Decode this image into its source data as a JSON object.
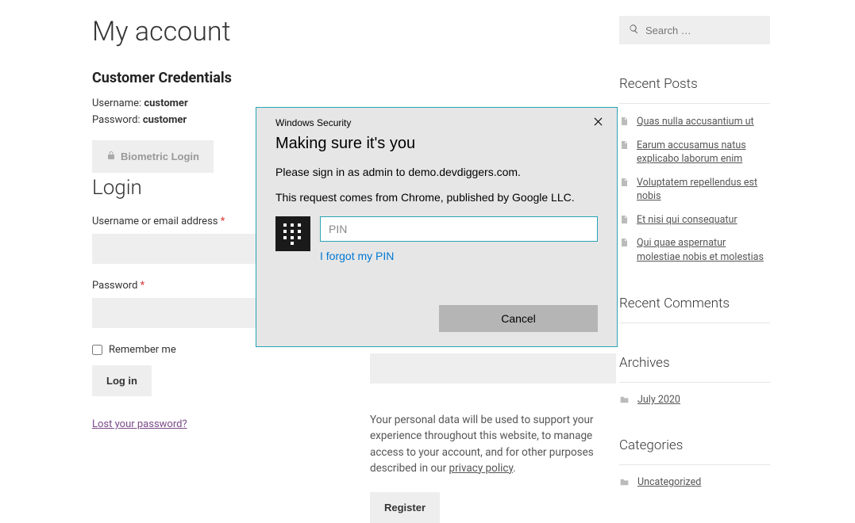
{
  "page": {
    "title": "My account",
    "credentials_heading": "Customer Credentials",
    "username_label": "Username:",
    "username_value": "customer",
    "password_label": "Password:",
    "password_value": "customer",
    "biometric_label": "Biometric Login",
    "login_heading": "Login"
  },
  "login_form": {
    "username_label": "Username or email address",
    "password_label": "Password",
    "remember_label": "Remember me",
    "login_button": "Log in",
    "lost_password": "Lost your password?"
  },
  "register_form": {
    "privacy_note_prefix": "Your personal data will be used to support your experience throughout this website, to manage access to your account, and for other purposes described in our ",
    "privacy_link": "privacy policy",
    "register_button": "Register"
  },
  "search": {
    "placeholder": "Search …"
  },
  "recent_posts": {
    "heading": "Recent Posts",
    "items": [
      {
        "title": "Quas nulla accusantium ut"
      },
      {
        "title": "Earum accusamus natus explicabo laborum enim"
      },
      {
        "title": "Voluptatem repellendus est nobis"
      },
      {
        "title": "Et nisi qui consequatur"
      },
      {
        "title": "Qui quae aspernatur molestiae nobis et molestias"
      }
    ]
  },
  "recent_comments": {
    "heading": "Recent Comments"
  },
  "archives": {
    "heading": "Archives",
    "items": [
      {
        "label": "July 2020"
      }
    ]
  },
  "categories": {
    "heading": "Categories",
    "items": [
      {
        "label": "Uncategorized"
      }
    ]
  },
  "dialog": {
    "window_title": "Windows Security",
    "main_title": "Making sure it's you",
    "line1": "Please sign in as admin to demo.devdiggers.com.",
    "line2": "This request comes from Chrome, published by Google LLC.",
    "pin_placeholder": "PIN",
    "forgot_pin": "I forgot my PIN",
    "cancel": "Cancel"
  }
}
